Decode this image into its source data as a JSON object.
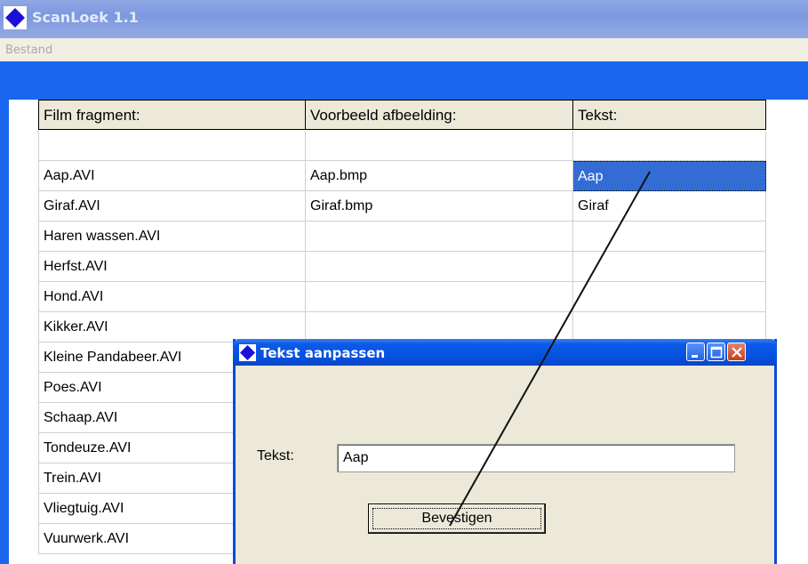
{
  "app": {
    "title": "ScanLoek 1.1",
    "menu": [
      "Bestand"
    ]
  },
  "grid": {
    "headers": [
      "Film fragment:",
      "Voorbeeld afbeelding:",
      "Tekst:"
    ],
    "rows": [
      [
        "",
        "",
        ""
      ],
      [
        "Aap.AVI",
        "Aap.bmp",
        "Aap"
      ],
      [
        "Giraf.AVI",
        "Giraf.bmp",
        "Giraf"
      ],
      [
        "Haren wassen.AVI",
        "",
        ""
      ],
      [
        "Herfst.AVI",
        "",
        ""
      ],
      [
        "Hond.AVI",
        "",
        ""
      ],
      [
        "Kikker.AVI",
        "",
        ""
      ],
      [
        "Kleine Pandabeer.AVI",
        "",
        ""
      ],
      [
        "Poes.AVI",
        "",
        ""
      ],
      [
        "Schaap.AVI",
        "",
        ""
      ],
      [
        "Tondeuze.AVI",
        "",
        ""
      ],
      [
        "Trein.AVI",
        "",
        ""
      ],
      [
        "Vliegtuig.AVI",
        "",
        ""
      ],
      [
        "Vuurwerk.AVI",
        "",
        ""
      ]
    ],
    "selected": {
      "row": 1,
      "col": 2
    }
  },
  "dialog": {
    "title": "Tekst aanpassen",
    "label": "Tekst:",
    "input_value": "Aap",
    "button_label": "Bevestigen"
  },
  "colors": {
    "client_blue": "#1b66ee",
    "selection": "#336dd4",
    "dialog_face": "#ece9d8"
  },
  "icons": {
    "app": "blue-diamond-icon",
    "minimize": "minimize-icon",
    "maximize": "maximize-icon",
    "close": "close-icon"
  }
}
